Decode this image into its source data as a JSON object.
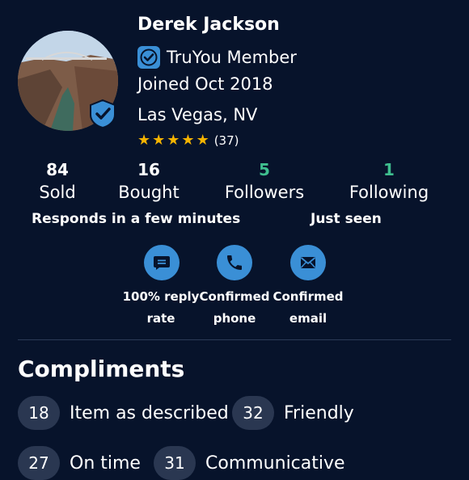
{
  "profile": {
    "name": "Derek Jackson",
    "member_label": "TruYou Member",
    "joined": "Joined Oct 2018",
    "location": "Las Vegas, NV",
    "rating_stars": 5,
    "rating_count": "(37)"
  },
  "stats": [
    {
      "value": "84",
      "label": "Sold"
    },
    {
      "value": "16",
      "label": "Bought"
    },
    {
      "value": "5",
      "label": "Followers"
    },
    {
      "value": "1",
      "label": "Following"
    }
  ],
  "response_time": "Responds in a few minutes",
  "last_seen": "Just seen",
  "confirmations": [
    {
      "icon": "message-icon",
      "line1": "100% reply",
      "line2": "rate"
    },
    {
      "icon": "phone-icon",
      "line1": "Confirmed",
      "line2": "phone"
    },
    {
      "icon": "email-icon",
      "line1": "Confirmed",
      "line2": "email"
    }
  ],
  "compliments": {
    "title": "Compliments",
    "items": [
      {
        "count": "18",
        "label": "Item as described"
      },
      {
        "count": "32",
        "label": "Friendly"
      },
      {
        "count": "27",
        "label": "On time"
      },
      {
        "count": "31",
        "label": "Communicative"
      }
    ]
  },
  "colors": {
    "background": "#07132b",
    "accent_blue": "#3a8fd6",
    "highlight_green": "#3fbf8f",
    "star": "#f5b400",
    "chip": "#2a3751"
  }
}
